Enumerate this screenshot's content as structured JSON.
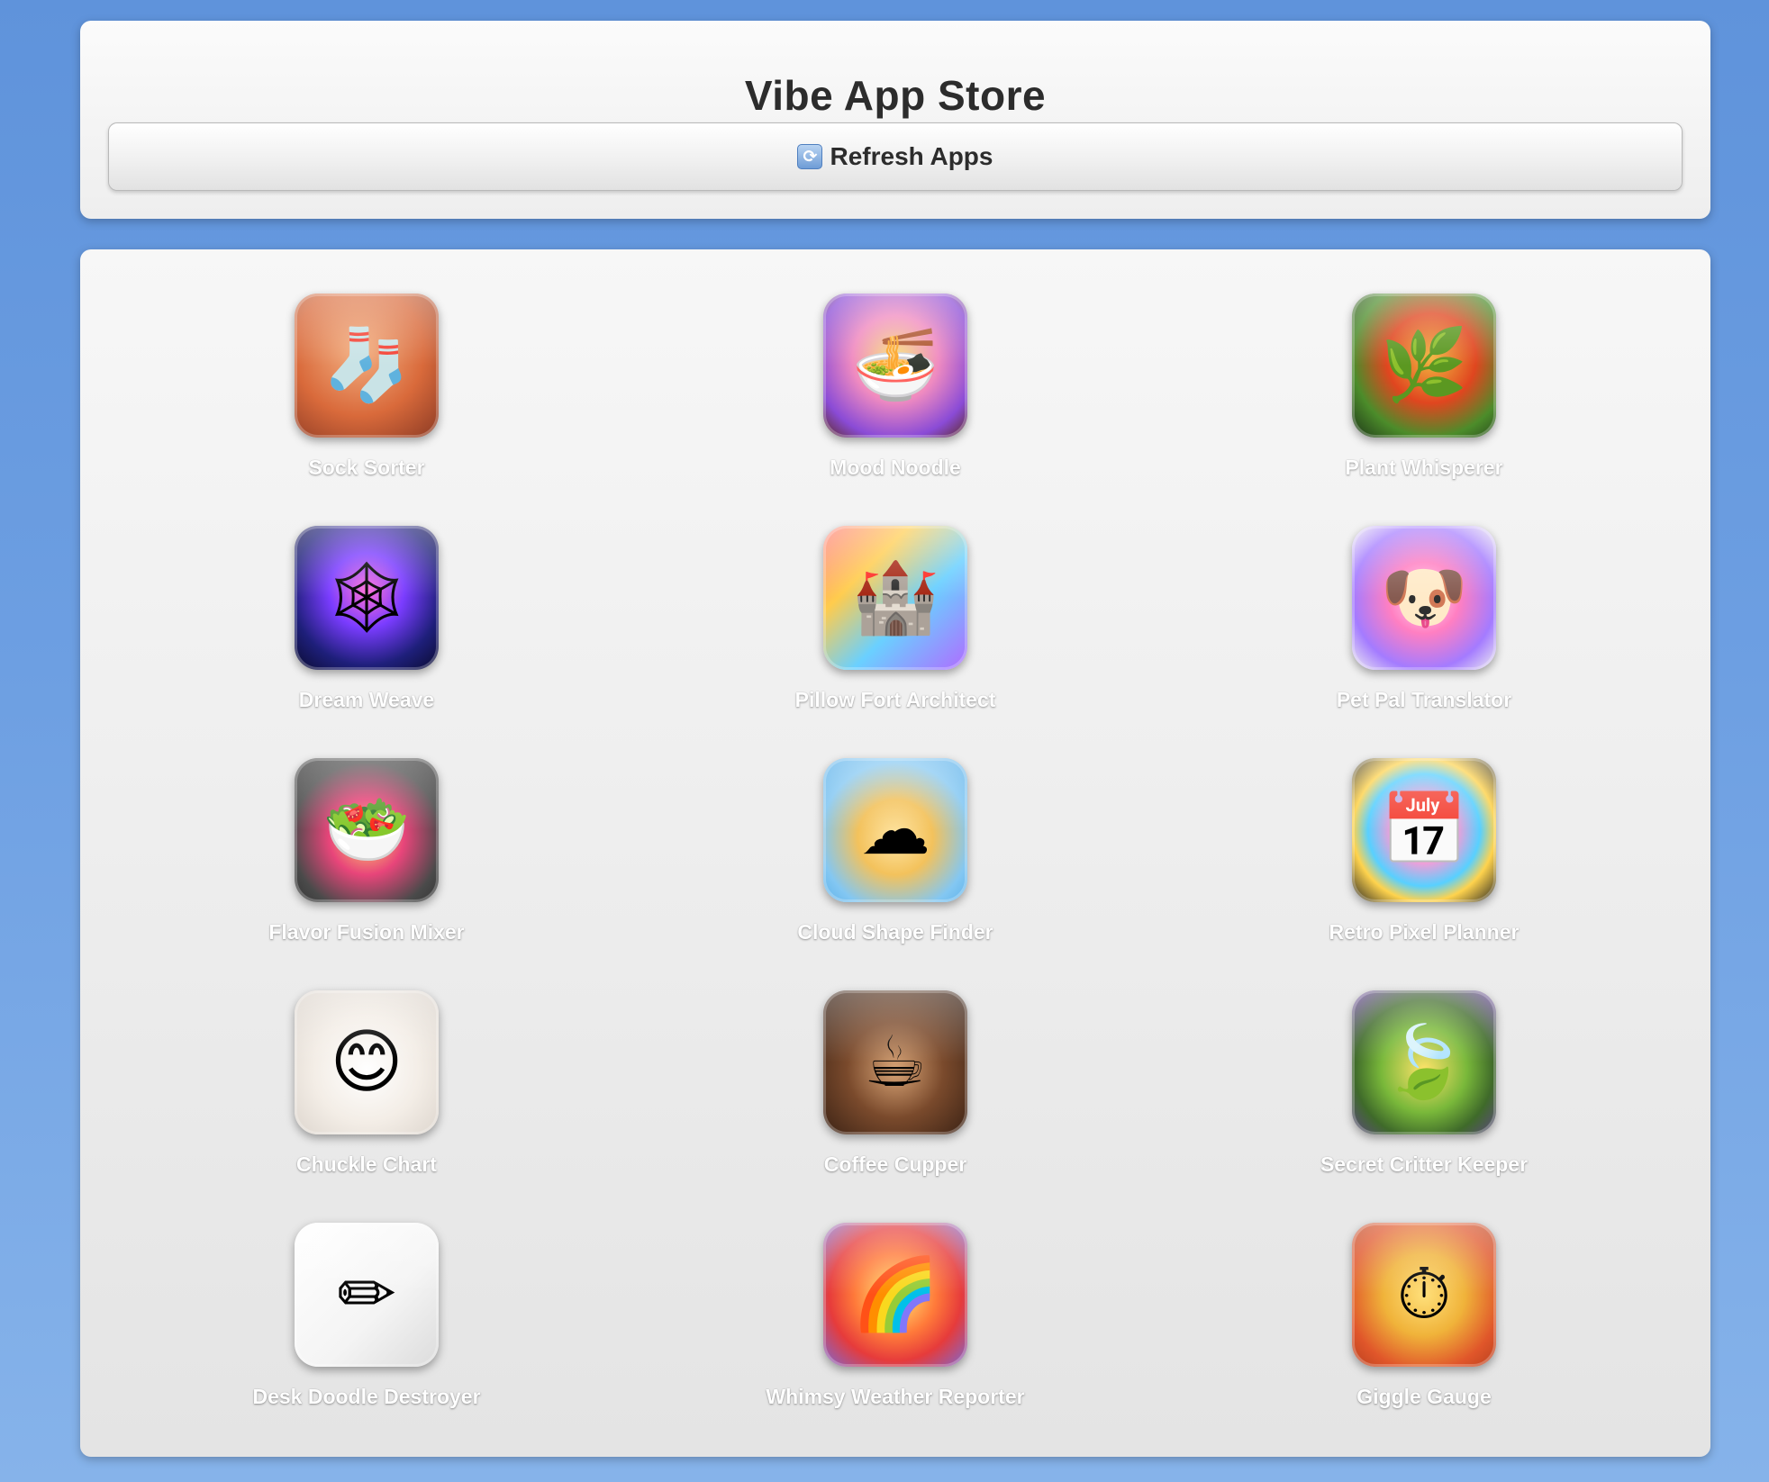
{
  "header": {
    "title": "Vibe App Store",
    "refresh_label": "Refresh Apps",
    "refresh_icon": "refresh-icon"
  },
  "apps": [
    {
      "name": "Sock Sorter",
      "icon": "sock-basket-icon",
      "glyph": "🧦"
    },
    {
      "name": "Mood Noodle",
      "icon": "noodle-face-icon",
      "glyph": "🍜"
    },
    {
      "name": "Plant Whisperer",
      "icon": "leaf-icon",
      "glyph": "🌿"
    },
    {
      "name": "Dream Weave",
      "icon": "dreamcatcher-icon",
      "glyph": "🕸"
    },
    {
      "name": "Pillow Fort Architect",
      "icon": "pillow-fort-icon",
      "glyph": "🏰"
    },
    {
      "name": "Pet Pal Translator",
      "icon": "pets-speech-icon",
      "glyph": "🐶"
    },
    {
      "name": "Flavor Fusion Mixer",
      "icon": "salad-bowl-icon",
      "glyph": "🥗"
    },
    {
      "name": "Cloud Shape Finder",
      "icon": "cloud-face-icon",
      "glyph": "☁"
    },
    {
      "name": "Retro Pixel Planner",
      "icon": "calendar-icon",
      "glyph": "📅"
    },
    {
      "name": "Chuckle Chart",
      "icon": "smiley-icon",
      "glyph": "😊"
    },
    {
      "name": "Coffee Cupper",
      "icon": "coffee-cup-icon",
      "glyph": "☕"
    },
    {
      "name": "Secret Critter Keeper",
      "icon": "fern-leaf-icon",
      "glyph": "🍃"
    },
    {
      "name": "Desk Doodle Destroyer",
      "icon": "pencil-icon",
      "glyph": "✏"
    },
    {
      "name": "Whimsy Weather Reporter",
      "icon": "sun-cloud-rainbow-icon",
      "glyph": "🌈"
    },
    {
      "name": "Giggle Gauge",
      "icon": "gauge-icon",
      "glyph": "⏱"
    }
  ]
}
